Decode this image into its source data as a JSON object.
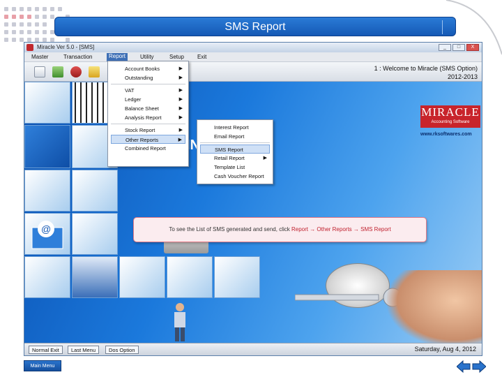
{
  "slide": {
    "title": "SMS Report",
    "main_menu_label": "Main Menu"
  },
  "window": {
    "title": "Miracle Ver 5.0 - [SMS]",
    "buttons": [
      "_",
      "□",
      "X"
    ]
  },
  "menubar": {
    "items": [
      "Master",
      "Transaction",
      "Report",
      "Utility",
      "Setup",
      "Exit"
    ],
    "active": "Report"
  },
  "toolbar": {
    "welcome_line1": "1 : Welcome to Miracle (SMS Option)",
    "welcome_line2": "2012-2013"
  },
  "report_menu": {
    "items": [
      {
        "label": "Account Books",
        "arrow": true
      },
      {
        "label": "Outstanding",
        "arrow": true
      },
      {
        "label": "VAT",
        "arrow": true
      },
      {
        "label": "Ledger",
        "arrow": true
      },
      {
        "label": "Balance Sheet",
        "arrow": true
      },
      {
        "label": "Analysis Report",
        "arrow": true
      },
      {
        "label": "Stock Report",
        "arrow": true
      },
      {
        "label": "Other Reports",
        "arrow": true
      },
      {
        "label": "Combined Report",
        "arrow": false
      }
    ],
    "selected": "Other Reports"
  },
  "other_reports_menu": {
    "items": [
      {
        "label": "Interest Report",
        "arrow": false
      },
      {
        "label": "Email Report",
        "arrow": false
      },
      {
        "label": "SMS Report",
        "arrow": false
      },
      {
        "label": "Retail Report",
        "arrow": true
      },
      {
        "label": "Template List",
        "arrow": false
      },
      {
        "label": "Cash Voucher Report",
        "arrow": false
      }
    ],
    "selected": "SMS Report"
  },
  "branding": {
    "logo": "MIRACLE",
    "tagline": "Accounting Software",
    "url": "www.rksoftwares.com",
    "big_text": "IN"
  },
  "statusbar": {
    "buttons": [
      "Normal Exit",
      "Last Menu",
      "Dos Option"
    ],
    "date": "Saturday, Aug 4, 2012"
  },
  "callout": {
    "prefix": "To see the List of SMS generated and send, click ",
    "path": "Report → Other Reports → SMS Report"
  },
  "colors": {
    "banner": "#1f6ccc",
    "accent_red": "#c0202e",
    "desktop_blue": "#1b79dc"
  }
}
